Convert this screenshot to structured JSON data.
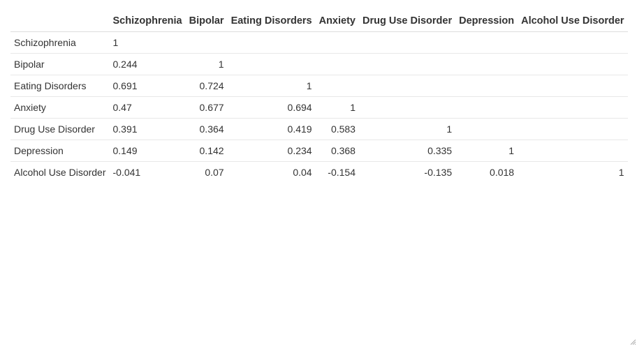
{
  "chart_data": {
    "type": "table",
    "columns": [
      "Schizophrenia",
      "Bipolar",
      "Eating Disorders",
      "Anxiety",
      "Drug Use Disorder",
      "Depression",
      "Alcohol Use Disorder"
    ],
    "rows": [
      {
        "label": "Schizophrenia",
        "cells": [
          "1",
          "",
          "",
          "",
          "",
          "",
          ""
        ]
      },
      {
        "label": "Bipolar",
        "cells": [
          "0.244",
          "1",
          "",
          "",
          "",
          "",
          ""
        ]
      },
      {
        "label": "Eating Disorders",
        "cells": [
          "0.691",
          "0.724",
          "1",
          "",
          "",
          "",
          ""
        ]
      },
      {
        "label": "Anxiety",
        "cells": [
          "0.47",
          "0.677",
          "0.694",
          "1",
          "",
          "",
          ""
        ]
      },
      {
        "label": "Drug Use Disorder",
        "cells": [
          "0.391",
          "0.364",
          "0.419",
          "0.583",
          "1",
          "",
          ""
        ]
      },
      {
        "label": "Depression",
        "cells": [
          "0.149",
          "0.142",
          "0.234",
          "0.368",
          "0.335",
          "1",
          ""
        ]
      },
      {
        "label": "Alcohol Use Disorder",
        "cells": [
          "-0.041",
          "0.07",
          "0.04",
          "-0.154",
          "-0.135",
          "0.018",
          "1"
        ]
      }
    ]
  },
  "icons": {
    "resize": "resize-grip-icon"
  }
}
